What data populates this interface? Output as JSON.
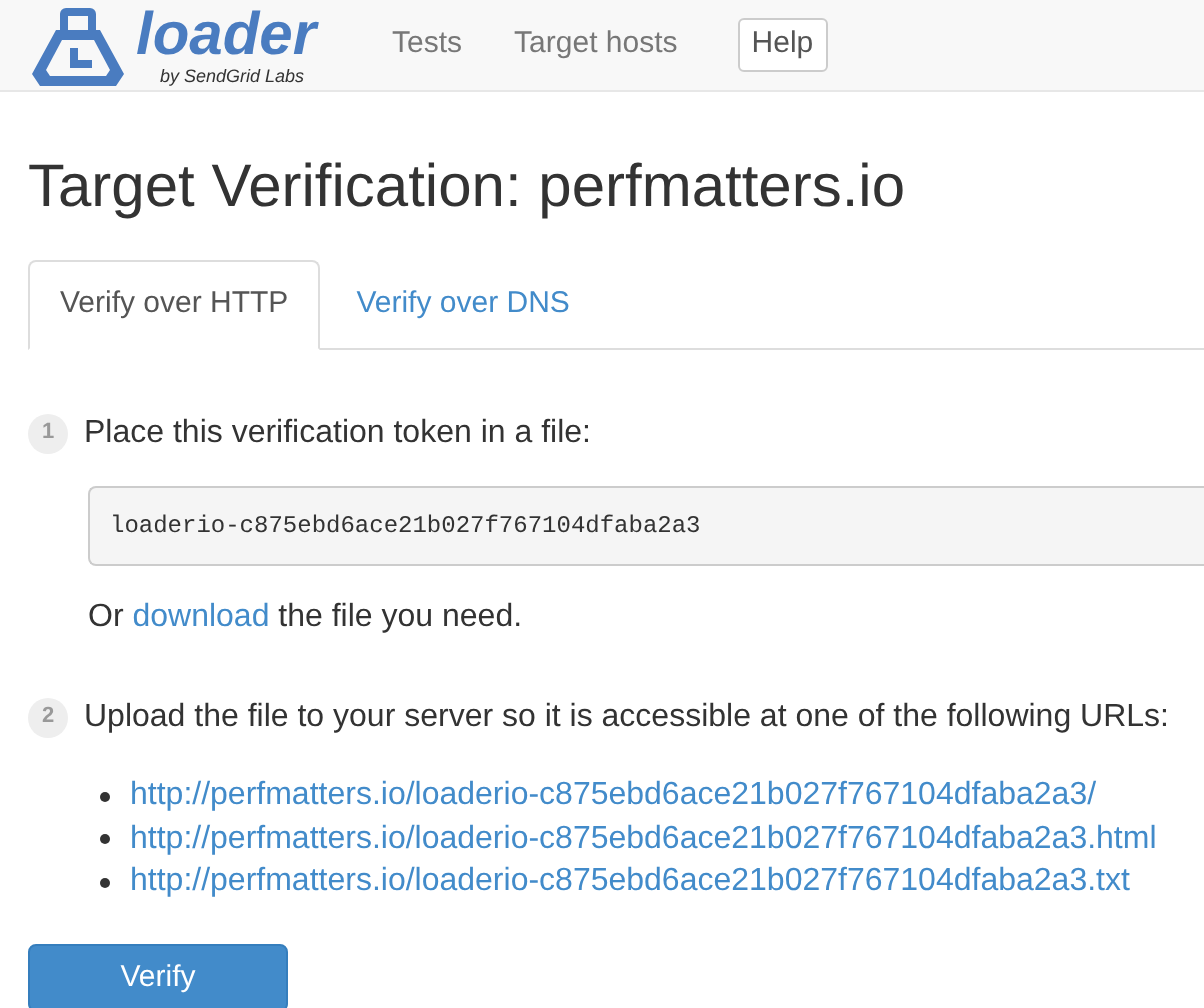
{
  "brand": {
    "name": "loader",
    "tagline": "by SendGrid Labs"
  },
  "nav": [
    {
      "label": "Tests",
      "kind": "link"
    },
    {
      "label": "Target hosts",
      "kind": "link"
    },
    {
      "label": "Help",
      "kind": "button"
    }
  ],
  "title": "Target Verification: perfmatters.io",
  "tabs": [
    {
      "label": "Verify over HTTP",
      "selected": true
    },
    {
      "label": "Verify over DNS",
      "selected": false
    }
  ],
  "steps": [
    {
      "number": "1",
      "text": "Place this verification token in a file:"
    },
    {
      "number": "2",
      "text": "Upload the file to your server so it is accessible at one of the following URLs:"
    }
  ],
  "token": "loaderio-c875ebd6ace21b027f767104dfaba2a3",
  "download_note": {
    "before": "Or ",
    "link": "download",
    "after": " the file you need."
  },
  "urls": [
    "http://perfmatters.io/loaderio-c875ebd6ace21b027f767104dfaba2a3/",
    "http://perfmatters.io/loaderio-c875ebd6ace21b027f767104dfaba2a3.html",
    "http://perfmatters.io/loaderio-c875ebd6ace21b027f767104dfaba2a3.txt"
  ],
  "verify_button": "Verify"
}
